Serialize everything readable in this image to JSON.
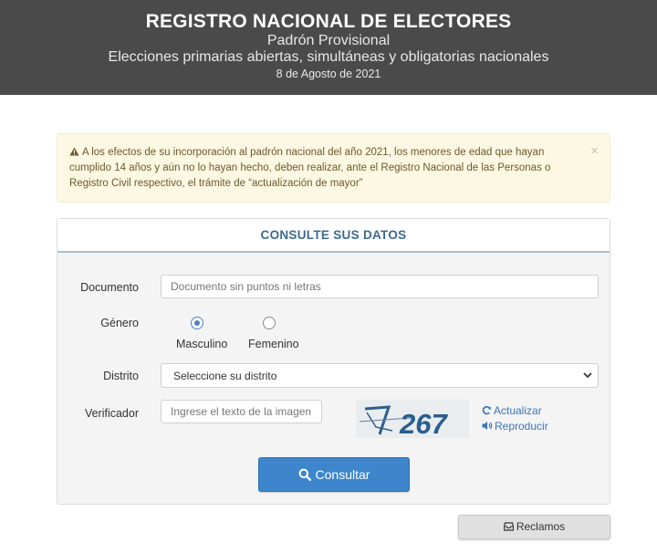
{
  "header": {
    "title": "REGISTRO NACIONAL DE ELECTORES",
    "subtitle": "Padrón Provisional",
    "election": "Elecciones primarias abiertas, simultáneas y obligatorias nacionales",
    "date": "8 de Agosto de 2021"
  },
  "alert": {
    "icon": "warning-icon",
    "text": "A los efectos de su incorporación al padrón nacional del año 2021, los menores de edad que hayan cumplido 14 años y aún no lo hayan hecho, deben realizar, ante el Registro Nacional de las Personas o Registro Civil respectivo, el trámite de “actualización de mayor”",
    "close": "×"
  },
  "form": {
    "title": "CONSULTE SUS DATOS",
    "documento": {
      "label": "Documento",
      "placeholder": "Documento sin puntos ni letras"
    },
    "genero": {
      "label": "Género",
      "options": [
        {
          "label": "Masculino",
          "checked": true
        },
        {
          "label": "Femenino",
          "checked": false
        }
      ]
    },
    "distrito": {
      "label": "Distrito",
      "selected": "Seleccione su distrito"
    },
    "verificador": {
      "label": "Verificador",
      "placeholder": "Ingrese el texto de la imagen",
      "captcha_text": "267",
      "refresh": "Actualizar",
      "play": "Reproducir"
    },
    "submit": "Consultar"
  },
  "reclamos": "Reclamos",
  "colors": {
    "header_bg": "#4a4a4a",
    "primary": "#3d86cc",
    "panel_title": "#3b6a8f",
    "alert_bg": "#fcf8e3",
    "link": "#3a76b8"
  }
}
